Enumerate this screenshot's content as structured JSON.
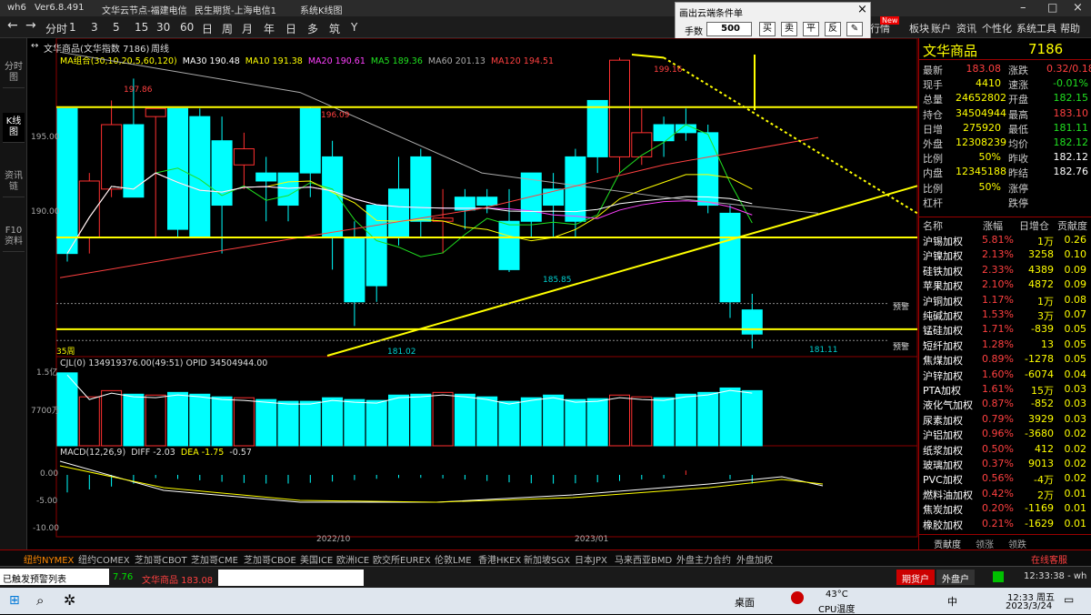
{
  "titlebar": {
    "app": "wh6",
    "version": "Ver6.8.491",
    "node": "文华云节点-福建电信",
    "broker": "民生期货-上海电信1",
    "sys_chart": "系统K线图"
  },
  "toolbar": {
    "periods": [
      "分时",
      "1",
      "3",
      "5",
      "15",
      "30",
      "60",
      "日",
      "周",
      "月",
      "年",
      "日",
      "多",
      "筑",
      "Y"
    ],
    "right_items": [
      "板块",
      "账户",
      "资讯",
      "个性化",
      "系统工具",
      "帮助"
    ],
    "new_badge": "New",
    "qu_label": "行情",
    "dt_label": "电"
  },
  "popup": {
    "title": "画出云端条件单",
    "qty_label": "手数",
    "qty_value": "500",
    "btns": [
      "买",
      "卖",
      "平",
      "反"
    ],
    "close": "×"
  },
  "leftnav": [
    {
      "label": "分时图"
    },
    {
      "label": "K线图",
      "active": true
    },
    {
      "label": "资讯链"
    },
    {
      "label": "F10资料"
    }
  ],
  "chart": {
    "header": {
      "title": "文华商品(文华指数 7186)",
      "period": "周线"
    },
    "ma_legend": [
      {
        "t": "MA组合(30,10,20,5,60,120)",
        "c": "#ffff00"
      },
      {
        "t": "MA30 190.48",
        "c": "#ffffff"
      },
      {
        "t": "MA10 191.38",
        "c": "#ffff00"
      },
      {
        "t": "MA20 190.61",
        "c": "#ff40ff"
      },
      {
        "t": "MA5 189.36",
        "c": "#20e020"
      },
      {
        "t": "MA60 201.13",
        "c": "#aaaaaa"
      },
      {
        "t": "MA120 194.51",
        "c": "#ff4040"
      }
    ],
    "price_labels": {
      "p195": "195.00",
      "p190": "190.00",
      "hi1": "197.86",
      "hi2": "196.09",
      "lo1": "185.85",
      "hi3": "199.16",
      "lo2": "181.02",
      "lo3": "181.11",
      "weeks": "35周",
      "yujing": "预警"
    },
    "vol_header": {
      "label": "CJL(0)",
      "val": "134919376.00(49:51)",
      "opid": "OPID 34504944.00"
    },
    "vol_axis": {
      "v1": "1.5亿",
      "v2": "7700万"
    },
    "macd_header": {
      "label": "MACD(12,26,9)",
      "diff": "DIFF -2.03",
      "dea": "DEA -1.75",
      "macd": "-0.57"
    },
    "macd_axis": {
      "a": "0.00",
      "b": "-5.00",
      "c": "-10.00"
    },
    "dates": {
      "d1": "2022/10",
      "d2": "2023/01"
    }
  },
  "chart_data": {
    "type": "candlestick",
    "instrument": "文华商品 7186",
    "period": "周线",
    "ohlc": [
      [
        196,
        187,
        196,
        186.5
      ],
      [
        188,
        191.5,
        192,
        187
      ],
      [
        191,
        195,
        196.5,
        190.5
      ],
      [
        195,
        190.5,
        197.86,
        190.5
      ],
      [
        195.5,
        196,
        196,
        188
      ],
      [
        196,
        188.5,
        196,
        188
      ],
      [
        195.5,
        188,
        196,
        188
      ],
      [
        194,
        190,
        195.5,
        187
      ],
      [
        192.5,
        193.5,
        194.5,
        191
      ],
      [
        192,
        191.5,
        193,
        189
      ],
      [
        192,
        190,
        192,
        189
      ],
      [
        196,
        192,
        196.09,
        190.5
      ],
      [
        193,
        188,
        194,
        186
      ],
      [
        188,
        184,
        189,
        182.5
      ],
      [
        190,
        185,
        190,
        184
      ],
      [
        191,
        188,
        193,
        187.5
      ],
      [
        193,
        189,
        193.5,
        188
      ],
      [
        189,
        189.2,
        191,
        187
      ],
      [
        190.5,
        189.7,
        191,
        188.5
      ],
      [
        190.5,
        190,
        191,
        189.5
      ],
      [
        189,
        186,
        191,
        185.85
      ],
      [
        192,
        189,
        192,
        188
      ],
      [
        191,
        190,
        192,
        188
      ],
      [
        193,
        189,
        193.5,
        188
      ],
      [
        196.5,
        193,
        196.5,
        192
      ],
      [
        193,
        199,
        199.16,
        192
      ],
      [
        193,
        194.5,
        196,
        192.5
      ],
      [
        195,
        194,
        195.5,
        193
      ],
      [
        195,
        194.5,
        196,
        194
      ],
      [
        194.5,
        190,
        195,
        189.5
      ],
      [
        189.5,
        184,
        190,
        183
      ],
      [
        183.5,
        182,
        184.5,
        181.11
      ]
    ],
    "volume": [
      82,
      55,
      62,
      58,
      57,
      60,
      58,
      55,
      54,
      52,
      50,
      50,
      54,
      52,
      51,
      57,
      58,
      60,
      58,
      55,
      50,
      54,
      57,
      52,
      53,
      57,
      55,
      54,
      58,
      60,
      65,
      62
    ]
  },
  "panel": {
    "title": "文华商品",
    "code": "7186",
    "quote": [
      {
        "l": "最新",
        "v": "183.08",
        "vc": "red",
        "l2": "涨跌",
        "v2": "0.32/0.18%",
        "v2c": "red"
      },
      {
        "l": "现手",
        "v": "4410",
        "vc": "yel",
        "l2": "速涨",
        "v2": "-0.01%",
        "v2c": "grn"
      },
      {
        "l": "总量",
        "v": "24652802",
        "vc": "yel",
        "l2": "开盘",
        "v2": "182.15",
        "v2c": "grn"
      },
      {
        "l": "持仓",
        "v": "34504944",
        "vc": "yel",
        "l2": "最高",
        "v2": "183.10",
        "v2c": "red"
      },
      {
        "l": "日增",
        "v": "275920",
        "vc": "yel",
        "l2": "最低",
        "v2": "181.11",
        "v2c": "grn"
      },
      {
        "l": "外盘",
        "v": "12308239",
        "vc": "yel",
        "l2": "均价",
        "v2": "182.12",
        "v2c": "grn"
      },
      {
        "l": "比例",
        "v": "50%",
        "vc": "yel",
        "l2": "昨收",
        "v2": "182.12",
        "v2c": "wht"
      },
      {
        "l": "内盘",
        "v": "12345188",
        "vc": "yel",
        "l2": "昨结",
        "v2": "182.76",
        "v2c": "wht"
      },
      {
        "l": "比例",
        "v": "50%",
        "vc": "yel",
        "l2": "涨停",
        "v2": "",
        "v2c": "wht"
      },
      {
        "l": "杠杆",
        "v": "",
        "vc": "yel",
        "l2": "跌停",
        "v2": "",
        "v2c": "wht"
      }
    ],
    "list_header": [
      "名称",
      "涨幅",
      "日增仓",
      "贡献度"
    ],
    "list": [
      [
        "沪锡加权",
        "5.81%",
        "1万",
        "0.26",
        "red"
      ],
      [
        "沪镍加权",
        "2.13%",
        "3258",
        "0.10",
        "red"
      ],
      [
        "硅铁加权",
        "2.33%",
        "4389",
        "0.09",
        "red"
      ],
      [
        "苹果加权",
        "2.10%",
        "4872",
        "0.09",
        "red"
      ],
      [
        "沪铜加权",
        "1.17%",
        "1万",
        "0.08",
        "red"
      ],
      [
        "纯碱加权",
        "1.53%",
        "3万",
        "0.07",
        "red"
      ],
      [
        "锰硅加权",
        "1.71%",
        "-839",
        "0.05",
        "red"
      ],
      [
        "短纤加权",
        "1.28%",
        "13",
        "0.05",
        "red"
      ],
      [
        "焦煤加权",
        "0.89%",
        "-1278",
        "0.05",
        "red"
      ],
      [
        "沪锌加权",
        "1.60%",
        "-6074",
        "0.04",
        "red"
      ],
      [
        "PTA加权",
        "1.61%",
        "15万",
        "0.03",
        "red"
      ],
      [
        "液化气加权",
        "0.87%",
        "-852",
        "0.03",
        "red"
      ],
      [
        "尿素加权",
        "0.79%",
        "3929",
        "0.03",
        "red"
      ],
      [
        "沪铝加权",
        "0.96%",
        "-3680",
        "0.02",
        "red"
      ],
      [
        "纸浆加权",
        "0.50%",
        "412",
        "0.02",
        "red"
      ],
      [
        "玻璃加权",
        "0.37%",
        "9013",
        "0.02",
        "red"
      ],
      [
        "PVC加权",
        "0.56%",
        "-4万",
        "0.02",
        "red"
      ],
      [
        "燃料油加权",
        "0.42%",
        "2万",
        "0.01",
        "red"
      ],
      [
        "焦炭加权",
        "0.20%",
        "-1169",
        "0.01",
        "red"
      ],
      [
        "橡胶加权",
        "0.21%",
        "-1629",
        "0.01",
        "red"
      ]
    ],
    "tabs": [
      "贡献度",
      "领涨",
      "领跌"
    ]
  },
  "bottomtabs": [
    "纽约NYMEX",
    "纽约COMEX",
    "芝加哥CBOT",
    "芝加哥CME",
    "芝加哥CBOE",
    "美国ICE",
    "欧洲ICE",
    "欧交所EUREX",
    "伦敦LME",
    "香港HKEX",
    "新加坡SGX",
    "日本JPX",
    "马来西亚BMD",
    "外盘主力合约",
    "外盘加权"
  ],
  "bottom_right": "在线客服",
  "statusbar": {
    "alert": "已触发预警列表",
    "ticker1": "7.76",
    "ticker2": "文华商品 183.08",
    "futures": "期货户",
    "outer": "外盘户",
    "time": "12:33:38 - wh"
  },
  "taskbar": {
    "desktop": "桌面",
    "temp": "43°C",
    "cpu": "CPU温度",
    "clock": "12:33 周五",
    "date": "2023/3/24",
    "ime": "中"
  }
}
